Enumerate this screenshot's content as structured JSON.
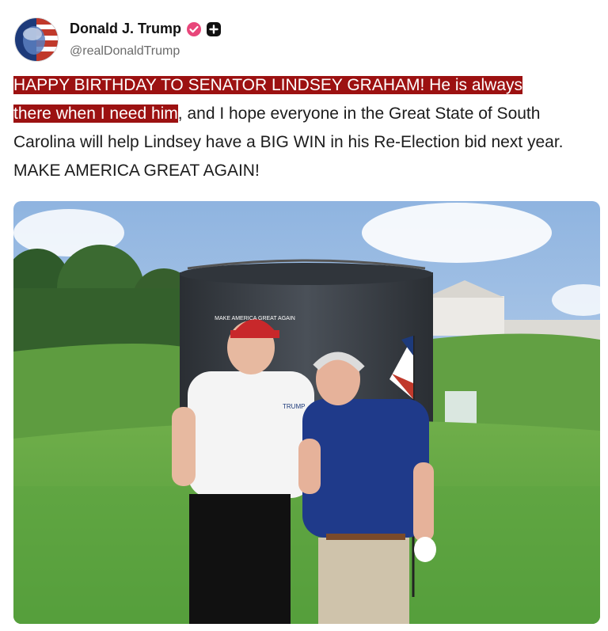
{
  "post": {
    "author_name": "Donald J. Trump",
    "author_handle": "@realDonaldTrump",
    "icons": {
      "verified": "verified-badge-icon",
      "plus": "plus-badge-icon"
    },
    "text_highlight_1": "HAPPY BIRTHDAY TO SENATOR LINDSEY GRAHAM! He is always",
    "text_highlight_2": "there when I need him",
    "text_rest": ", and I hope everyone in the Great State of South Carolina will help Lindsey have a BIG WIN in his Re-Election bid next year. MAKE AMERICA GREAT AGAIN!"
  },
  "photo": {
    "hat_text": "MAKE AMERICA GREAT AGAIN",
    "shirt_logo": "TRUMP"
  },
  "colors": {
    "highlight": "#9c1111",
    "verified": "#e8467a",
    "handle": "#6b6b6b"
  }
}
